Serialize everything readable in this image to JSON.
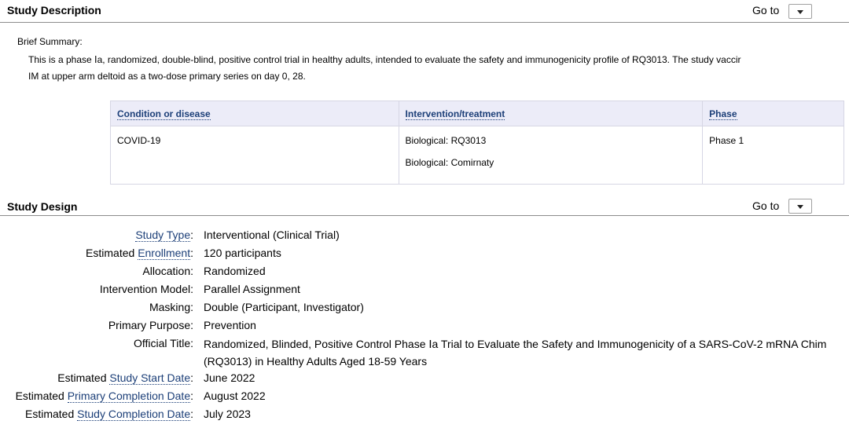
{
  "description": {
    "title": "Study Description",
    "goto_label": "Go to",
    "brief_label": "Brief Summary:",
    "brief_line1": "This is a phase Ⅰa, randomized, double-blind, positive control trial in healthy adults, intended to evaluate the safety and immunogenicity profile of RQ3013. The study vaccir",
    "brief_line2": "IM at upper arm deltoid as a two-dose primary series on day 0, 28."
  },
  "conditions_table": {
    "headers": [
      "Condition or disease",
      "Intervention/treatment",
      "Phase"
    ],
    "condition": "COVID-19",
    "interventions": [
      "Biological: RQ3013",
      "Biological: Comirnaty"
    ],
    "phase": "Phase 1"
  },
  "design": {
    "title": "Study Design",
    "goto_label": "Go to",
    "rows": [
      {
        "prefix": "",
        "link": "Study Type",
        "suffix": ":",
        "value": "Interventional  (Clinical Trial)"
      },
      {
        "prefix": "Estimated ",
        "link": "Enrollment",
        "suffix": ":",
        "value": "120 participants"
      },
      {
        "prefix": "Allocation:",
        "link": "",
        "suffix": "",
        "value": "Randomized"
      },
      {
        "prefix": "Intervention Model:",
        "link": "",
        "suffix": "",
        "value": "Parallel Assignment"
      },
      {
        "prefix": "Masking:",
        "link": "",
        "suffix": "",
        "value": "Double (Participant, Investigator)"
      },
      {
        "prefix": "Primary Purpose:",
        "link": "",
        "suffix": "",
        "value": "Prevention"
      },
      {
        "prefix": "Official Title:",
        "link": "",
        "suffix": "",
        "value": "Randomized, Blinded, Positive Control Phase Ⅰa Trial to Evaluate the Safety and Immunogenicity of a SARS-CoV-2 mRNA Chim",
        "value2": "(RQ3013) in Healthy Adults Aged 18-59 Years"
      },
      {
        "prefix": "Estimated ",
        "link": "Study Start Date",
        "suffix": ":",
        "value": "June 2022"
      },
      {
        "prefix": "Estimated ",
        "link": "Primary Completion Date",
        "suffix": ":",
        "value": "August 2022"
      },
      {
        "prefix": "Estimated ",
        "link": "Study Completion Date",
        "suffix": ":",
        "value": "July 2023"
      }
    ]
  }
}
